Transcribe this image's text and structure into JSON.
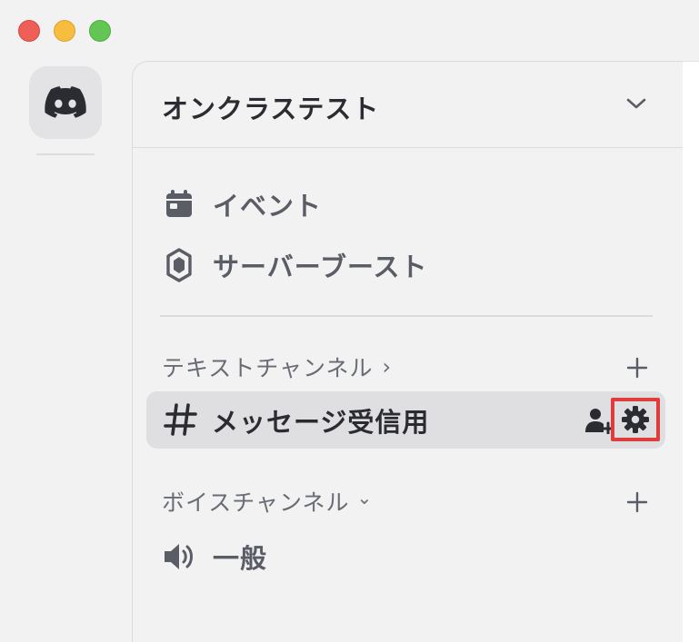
{
  "window": {
    "controls": [
      "close",
      "minimize",
      "zoom"
    ]
  },
  "rail": {
    "logo_icon": "discord-logo-icon"
  },
  "server": {
    "name": "オンクラステスト",
    "menu_icon": "chevron-down-icon"
  },
  "top_items": [
    {
      "label": "イベント",
      "icon": "calendar-icon"
    },
    {
      "label": "サーバーブースト",
      "icon": "boost-gem-icon"
    }
  ],
  "categories": {
    "text": {
      "label": "テキストチャンネル",
      "chevron": "›"
    },
    "voice": {
      "label": "ボイスチャンネル",
      "chevron": "⌄"
    }
  },
  "channels": {
    "text": [
      {
        "label": "メッセージ受信用",
        "icon": "hash-icon",
        "active": true
      }
    ],
    "voice": [
      {
        "label": "一般",
        "icon": "speaker-icon"
      }
    ]
  },
  "colors": {
    "highlight_box": "#e03c3c",
    "active_channel_bg": "#dfdfe2",
    "background": "#f2f2f3"
  }
}
